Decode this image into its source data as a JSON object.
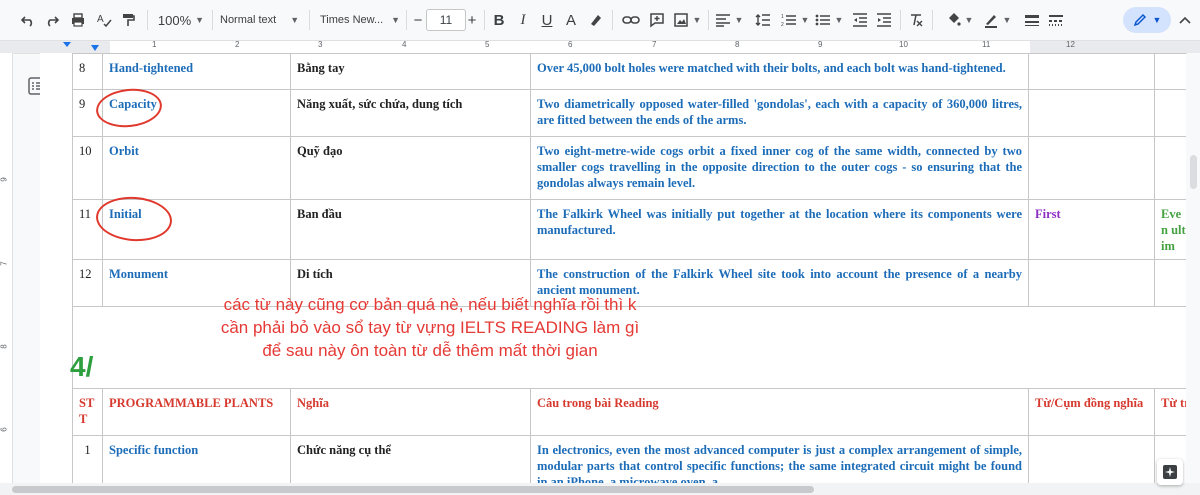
{
  "toolbar": {
    "zoom": "100%",
    "style": "Normal text",
    "font": "Times New...",
    "font_size": "11",
    "minus": "−",
    "plus": "+",
    "bold": "B",
    "italic": "I",
    "underline": "U",
    "text_color": "A"
  },
  "ruler": {
    "numbers": [
      "1",
      "2",
      "3",
      "4",
      "5",
      "6",
      "7",
      "8",
      "9",
      "10",
      "11",
      "12"
    ],
    "left_numbers": [
      "9",
      "7",
      "8",
      "6"
    ]
  },
  "table_top": {
    "rows": [
      {
        "stt": "8",
        "word": "Hand-tightened",
        "meaning": "Bằng tay",
        "sentence": "Over 45,000 bolt holes were matched with their bolts, and each bolt was hand-tightened.",
        "synonym": "",
        "extra": ""
      },
      {
        "stt": "9",
        "word": "Capacity",
        "meaning": "Năng xuất, sức chứa, dung tích",
        "sentence": "Two diametrically opposed water-filled 'gondolas', each with a capacity of 360,000 litres, are fitted between the ends of the arms.",
        "synonym": "",
        "extra": ""
      },
      {
        "stt": "10",
        "word": "Orbit",
        "meaning": "Quỹ đạo",
        "sentence": "Two eight-metre-wide cogs orbit a fixed inner cog of the same width, connected by two smaller cogs travelling in the opposite direction to the outer cogs - so ensuring that the gondolas always remain level.",
        "synonym": "",
        "extra": ""
      },
      {
        "stt": "11",
        "word": "Initial",
        "meaning": "Ban đầu",
        "sentence": "The Falkirk Wheel was initially put together at the location where its components were manufactured.",
        "synonym": "First",
        "extra": "Even ultim"
      },
      {
        "stt": "12",
        "word": "Monument",
        "meaning": "Di tích",
        "sentence": "The construction of the Falkirk Wheel site took into account the presence of a nearby ancient monument.",
        "synonym": "",
        "extra": ""
      }
    ]
  },
  "note": {
    "line1": "các từ này cũng cơ bản quá nè, nếu biết nghĩa rồi thì k",
    "line2": "cần phải bỏ vào sổ tay từ vựng IELTS READING làm gì",
    "line3": "để sau này ôn toàn từ dễ thêm mất thời gian"
  },
  "section_number": "4/",
  "table_bottom": {
    "headers": {
      "stt": "ST T",
      "word": "PROGRAMMABLE PLANTS",
      "meaning": "Nghĩa",
      "sentence": "Câu trong bài Reading",
      "synonym": "Từ/Cụm đồng nghĩa",
      "extra": "Từ tr"
    },
    "rows": [
      {
        "stt": "1",
        "word": "Specific function",
        "meaning": "Chức năng cụ thể",
        "sentence": "In electronics, even the most advanced computer is just a complex arrangement of simple, modular parts that control specific functions; the same integrated circuit might be found in an iPhone, a microwave oven, a"
      }
    ]
  },
  "colors": {
    "blue": "#1c6cb8",
    "red": "#d63a2f",
    "green": "#46a142",
    "purple": "#8e2ec2"
  }
}
